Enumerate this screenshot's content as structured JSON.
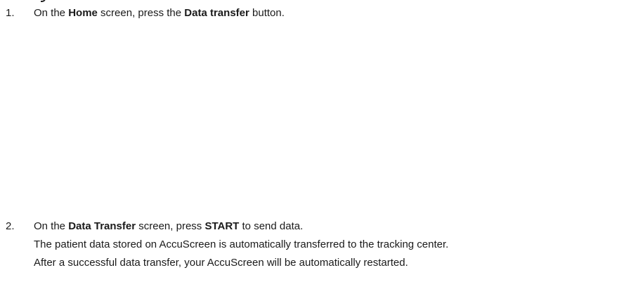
{
  "steps": [
    {
      "number": "1.",
      "parts": [
        "On the ",
        "Home",
        " screen, press the ",
        "Data transfer",
        " button."
      ]
    },
    {
      "number": "2.",
      "parts": [
        "On the ",
        "Data Transfer",
        " screen, press ",
        "START",
        " to send data."
      ],
      "details": [
        "The patient data stored on AccuScreen is automatically transferred to the tracking center.",
        "After a successful data transfer, your AccuScreen will be automatically restarted."
      ]
    }
  ]
}
